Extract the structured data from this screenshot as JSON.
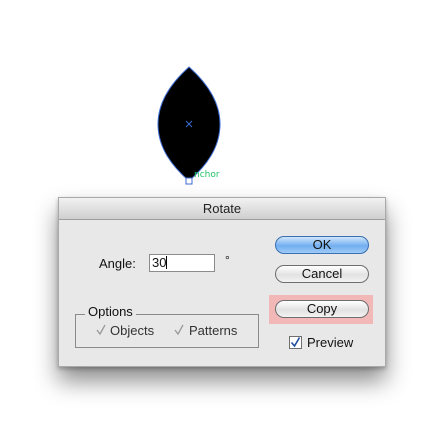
{
  "canvas": {
    "anchor_label": "nchor"
  },
  "dialog": {
    "title": "Rotate",
    "angle_label": "Angle:",
    "angle_value": "30",
    "degree_symbol": "°",
    "options": {
      "legend": "Options",
      "objects_label": "Objects",
      "objects_checked": true,
      "patterns_label": "Patterns",
      "patterns_checked": true
    },
    "buttons": {
      "ok": "OK",
      "cancel": "Cancel",
      "copy": "Copy"
    },
    "preview_label": "Preview",
    "preview_checked": true
  },
  "colors": {
    "shape_fill": "#000000",
    "shape_outline": "#3d6bd1",
    "anchor_color": "#22c46a",
    "copy_highlight": "#f2b8b8",
    "ok_button": "#72aef0"
  }
}
